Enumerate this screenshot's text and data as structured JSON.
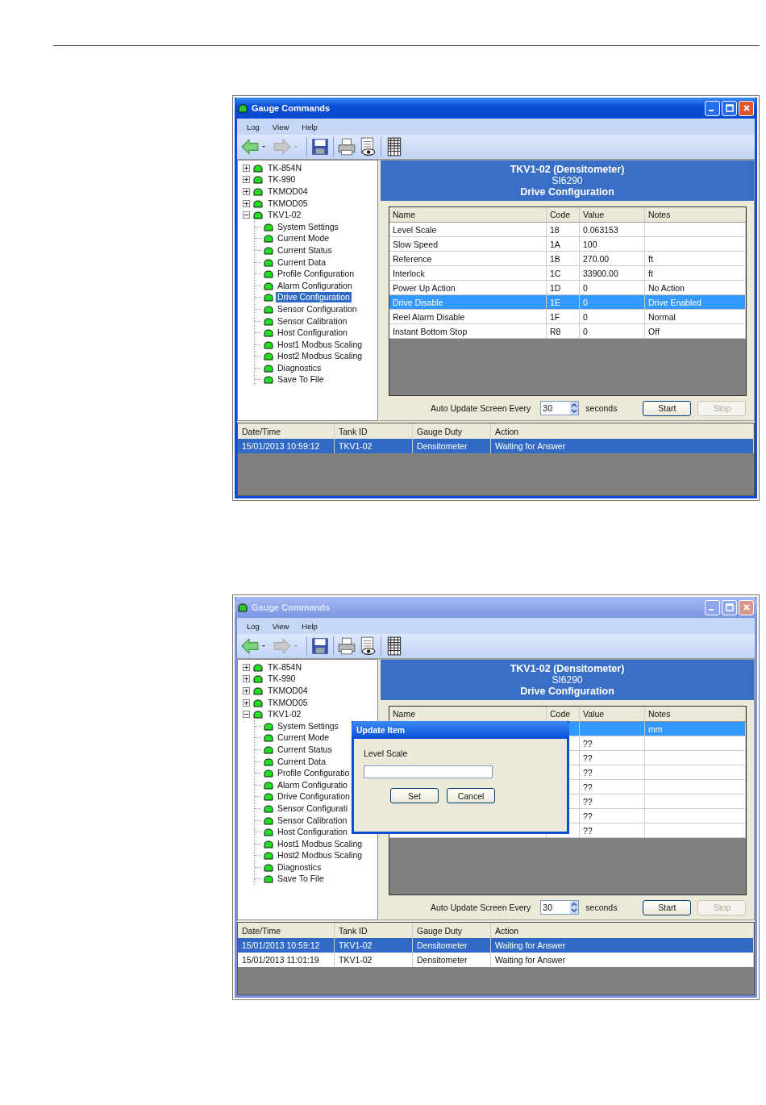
{
  "windows": [
    {
      "title": "Gauge Commands",
      "active": true,
      "menu": [
        "Log",
        "View",
        "Help"
      ],
      "tree": [
        {
          "label": "TK-854N",
          "expanded": false,
          "selected": false
        },
        {
          "label": "TK-990",
          "expanded": false,
          "selected": false
        },
        {
          "label": "TKMOD04",
          "expanded": false,
          "selected": false
        },
        {
          "label": "TKMOD05",
          "expanded": false,
          "selected": false
        },
        {
          "label": "TKV1-02",
          "expanded": true,
          "selected": false,
          "children": [
            {
              "label": "System Settings",
              "selected": false
            },
            {
              "label": "Current Mode",
              "selected": false
            },
            {
              "label": "Current Status",
              "selected": false
            },
            {
              "label": "Current Data",
              "selected": false
            },
            {
              "label": "Profile Configuration",
              "selected": false
            },
            {
              "label": "Alarm Configuration",
              "selected": false
            },
            {
              "label": "Drive Configuration",
              "selected": true
            },
            {
              "label": "Sensor Configuration",
              "selected": false
            },
            {
              "label": "Sensor Calibration",
              "selected": false
            },
            {
              "label": "Host Configuration",
              "selected": false
            },
            {
              "label": "Host1 Modbus Scaling",
              "selected": false
            },
            {
              "label": "Host2 Modbus Scaling",
              "selected": false
            },
            {
              "label": "Diagnostics",
              "selected": false
            },
            {
              "label": "Save To File",
              "selected": false
            }
          ]
        }
      ],
      "header": [
        "TKV1-02 (Densitometer)",
        "SI6290",
        "Drive Configuration"
      ],
      "grid": {
        "columns": [
          "Name",
          "Code",
          "Value",
          "Notes"
        ],
        "rows": [
          {
            "name": "Level Scale",
            "code": "18",
            "value": "0.063153",
            "notes": "",
            "selected": false
          },
          {
            "name": "Slow Speed",
            "code": "1A",
            "value": "100",
            "notes": "",
            "selected": false
          },
          {
            "name": "Reference",
            "code": "1B",
            "value": "270.00",
            "notes": "ft",
            "selected": false
          },
          {
            "name": "Interlock",
            "code": "1C",
            "value": "33900.00",
            "notes": "ft",
            "selected": false
          },
          {
            "name": "Power Up Action",
            "code": "1D",
            "value": "0",
            "notes": "No Action",
            "selected": false
          },
          {
            "name": "Drive Disable",
            "code": "1E",
            "value": "0",
            "notes": "Drive Enabled",
            "selected": true
          },
          {
            "name": "Reel Alarm Disable",
            "code": "1F",
            "value": "0",
            "notes": "Normal",
            "selected": false
          },
          {
            "name": "Instant Bottom Stop",
            "code": "R8",
            "value": "0",
            "notes": "Off",
            "selected": false
          }
        ]
      },
      "auto_update": {
        "label": "Auto Update Screen Every",
        "value": "30",
        "unit": "seconds"
      },
      "buttons": [
        {
          "label": "Start",
          "disabled": false
        },
        {
          "label": "Stop",
          "disabled": true
        }
      ],
      "log": {
        "columns": [
          "Date/Time",
          "Tank ID",
          "Gauge Duty",
          "Action"
        ],
        "rows": [
          {
            "cells": [
              "15/01/2013 10:59:12",
              "TKV1-02",
              "Densitometer",
              "Waiting for Answer"
            ],
            "selected": true
          }
        ]
      }
    },
    {
      "title": "Gauge Commands",
      "active": false,
      "menu": [
        "Log",
        "View",
        "Help"
      ],
      "tree": [
        {
          "label": "TK-854N",
          "expanded": false,
          "selected": false
        },
        {
          "label": "TK-990",
          "expanded": false,
          "selected": false
        },
        {
          "label": "TKMOD04",
          "expanded": false,
          "selected": false
        },
        {
          "label": "TKMOD05",
          "expanded": false,
          "selected": false
        },
        {
          "label": "TKV1-02",
          "expanded": true,
          "selected": false,
          "children": [
            {
              "label": "System Settings",
              "selected": false
            },
            {
              "label": "Current Mode",
              "selected": false
            },
            {
              "label": "Current Status",
              "selected": false
            },
            {
              "label": "Current Data",
              "selected": false
            },
            {
              "label": "Profile Configuratio",
              "selected": false
            },
            {
              "label": "Alarm Configuratio",
              "selected": false
            },
            {
              "label": "Drive Configuration",
              "selected": false
            },
            {
              "label": "Sensor Configurati",
              "selected": false
            },
            {
              "label": "Sensor Calibration",
              "selected": false
            },
            {
              "label": "Host Configuration",
              "selected": false
            },
            {
              "label": "Host1 Modbus Scaling",
              "selected": false
            },
            {
              "label": "Host2 Modbus Scaling",
              "selected": false
            },
            {
              "label": "Diagnostics",
              "selected": false
            },
            {
              "label": "Save To File",
              "selected": false
            }
          ]
        }
      ],
      "header": [
        "TKV1-02 (Densitometer)",
        "SI6290",
        "Drive Configuration"
      ],
      "grid": {
        "columns": [
          "Name",
          "Code",
          "Value",
          "Notes"
        ],
        "rows": [
          {
            "name": "",
            "code": "",
            "value": "",
            "notes": "mm",
            "selected": true
          },
          {
            "name": "",
            "code": "",
            "value": "??",
            "notes": "",
            "selected": false
          },
          {
            "name": "",
            "code": "",
            "value": "??",
            "notes": "",
            "selected": false
          },
          {
            "name": "",
            "code": "",
            "value": "??",
            "notes": "",
            "selected": false
          },
          {
            "name": "",
            "code": "",
            "value": "??",
            "notes": "",
            "selected": false
          },
          {
            "name": "",
            "code": "",
            "value": "??",
            "notes": "",
            "selected": false
          },
          {
            "name": "",
            "code": "",
            "value": "??",
            "notes": "",
            "selected": false
          },
          {
            "name": "",
            "code": "",
            "value": "??",
            "notes": "",
            "selected": false
          }
        ]
      },
      "auto_update": {
        "label": "Auto Update Screen Every",
        "value": "30",
        "unit": "seconds"
      },
      "buttons": [
        {
          "label": "Start",
          "disabled": false
        },
        {
          "label": "Stop",
          "disabled": true
        }
      ],
      "log": {
        "columns": [
          "Date/Time",
          "Tank ID",
          "Gauge Duty",
          "Action"
        ],
        "rows": [
          {
            "cells": [
              "15/01/2013 10:59:12",
              "TKV1-02",
              "Densitometer",
              "Waiting for Answer"
            ],
            "selected": true
          },
          {
            "cells": [
              "15/01/2013 11:01:19",
              "TKV1-02",
              "Densitometer",
              "Waiting for Answer"
            ],
            "selected": false
          }
        ]
      },
      "dialog": {
        "title": "Update Item",
        "label": "Level Scale",
        "buttons": [
          "Set",
          "Cancel"
        ]
      }
    }
  ]
}
